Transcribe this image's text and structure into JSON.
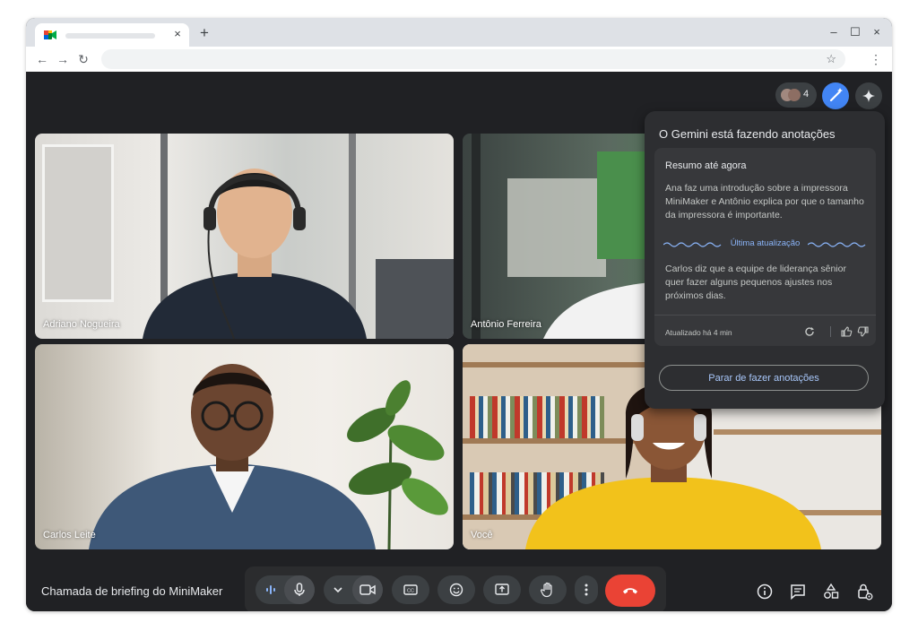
{
  "browser": {
    "new_tab": "+",
    "tab_close": "×",
    "window_controls": [
      "–",
      "☐",
      "×"
    ],
    "nav": {
      "back": "←",
      "forward": "→",
      "reload": "↻"
    },
    "bookmark": "☆",
    "menu": "⋮"
  },
  "meet": {
    "participants_count": "4",
    "tiles": [
      {
        "name": "Adriano Nogueira"
      },
      {
        "name": "Antônio Ferreira"
      },
      {
        "name": "Carlos Leite"
      },
      {
        "name": "Você"
      }
    ],
    "gemini_panel": {
      "title": "O Gemini está fazendo anotações",
      "summary_heading": "Resumo até agora",
      "summary_text": "Ana faz uma introdução sobre a impressora MiniMaker e Antônio explica por que o tamanho da impressora é importante.",
      "divider_label": "Última atualização",
      "update_text": "Carlos diz que a equipe de liderança sênior quer fazer alguns pequenos ajustes nos próximos dias.",
      "updated_label": "Atualizado há 4 min",
      "stop_button": "Parar de fazer anotações"
    },
    "meeting_title": "Chamada de briefing do MiniMaker",
    "colors": {
      "accent_blue": "#8ab4f8",
      "end_call_red": "#ea4335",
      "panel_bg": "#2d2e31"
    },
    "controls": [
      "voice-activity-icon",
      "mic-icon",
      "chevron-down-icon",
      "camera-icon",
      "captions-icon",
      "emoji-icon",
      "present-icon",
      "raise-hand-icon",
      "more-options-icon",
      "end-call-icon"
    ],
    "right_controls": [
      "info-icon",
      "chat-icon",
      "activities-icon",
      "host-controls-icon"
    ]
  }
}
